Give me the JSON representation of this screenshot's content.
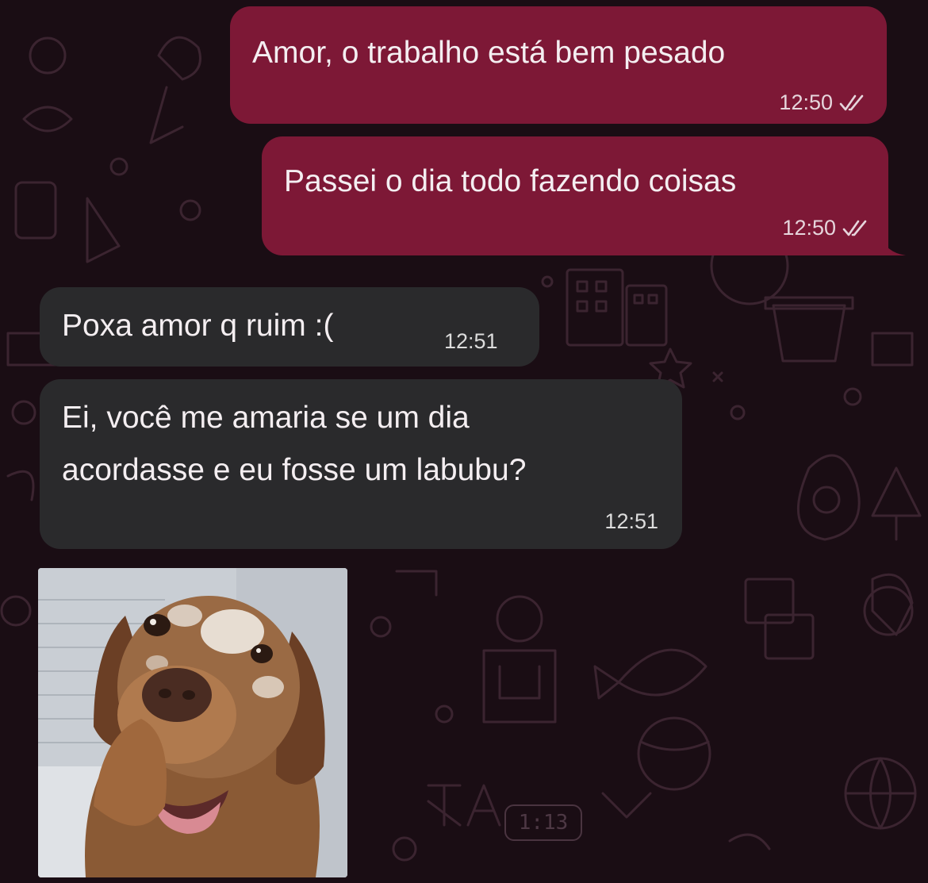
{
  "conversation": {
    "messages": [
      {
        "direction": "outgoing",
        "text": "Amor, o trabalho está bem pesado",
        "time": "12:50",
        "status_icon": "double-check-icon"
      },
      {
        "direction": "outgoing",
        "text": "Passei o dia todo fazendo coisas",
        "time": "12:50",
        "status_icon": "double-check-icon"
      },
      {
        "direction": "incoming",
        "text": "Poxa amor q ruim :(",
        "time": "12:51"
      },
      {
        "direction": "incoming",
        "lines": [
          "Ei, você me amaria se um dia",
          "acordasse e eu fosse um labubu?"
        ],
        "time": "12:51"
      },
      {
        "direction": "incoming",
        "type": "image",
        "image": "dachshund-photo"
      }
    ]
  },
  "wallpaper": {
    "doodle_duration_label": "1:13"
  },
  "colors": {
    "background": "#1a0d14",
    "outgoing_bubble": "#7d1836",
    "incoming_bubble": "#2a2a2c",
    "doodle_stroke": "#3b2430"
  }
}
